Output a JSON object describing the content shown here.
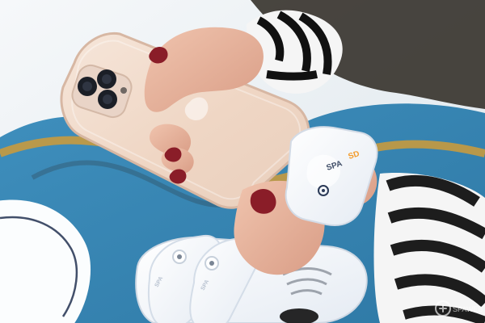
{
  "scene": {
    "alt": "Hands holding a gold smartphone and a white round power bank cube above a marble table with white charging pods",
    "colors": {
      "table_base": "#e7edf1",
      "table_blue": "#2f86b8",
      "table_gold": "#c79a3f",
      "phone_gold": "#efd6c4",
      "skin": "#e4b39c",
      "nail": "#8a1d28",
      "sleeve_dark": "#111111",
      "sleeve_light": "#f5f5f5",
      "device_white": "#f7f9fc",
      "brand_orange": "#f39b2b"
    }
  },
  "branding": {
    "device_text_primary": "SPA",
    "device_text_secondary": "SD",
    "pod_text_left": "SPA",
    "pod_text_right": "SPA"
  },
  "watermark": {
    "text": "®",
    "secondary": "SPAWEB"
  }
}
